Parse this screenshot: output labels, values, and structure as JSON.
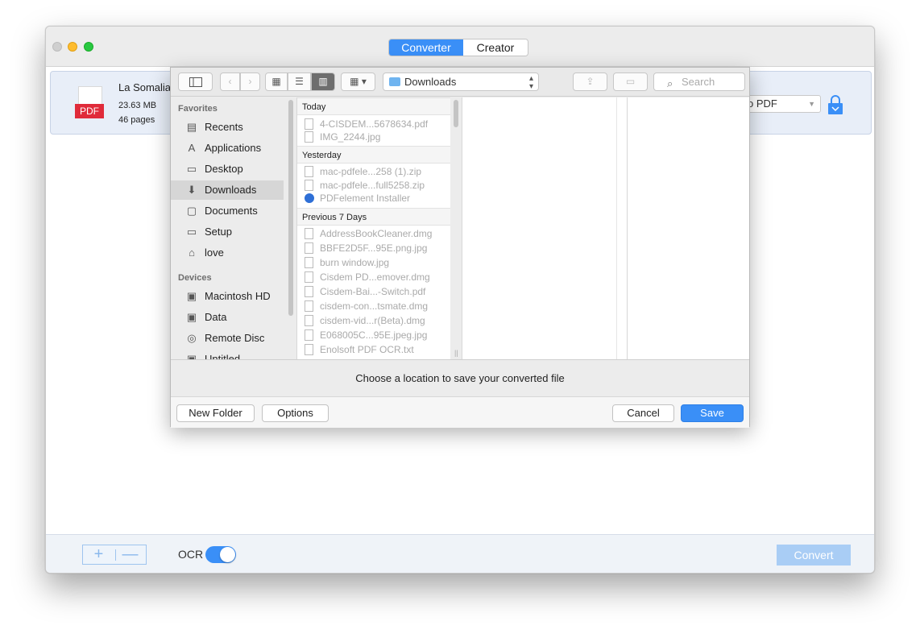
{
  "app": {
    "tabs": [
      {
        "label": "Converter",
        "active": true
      },
      {
        "label": "Creator",
        "active": false
      }
    ],
    "accent_color": "#3a8ff7"
  },
  "file": {
    "name": "La Somalia",
    "badge": "PDF",
    "size": "23.63 MB",
    "pages": "46 pages",
    "format": "o PDF"
  },
  "bottom": {
    "add_label": "+",
    "remove_label": "—",
    "ocr_label": "OCR",
    "ocr_enabled": true,
    "convert_label": "Convert"
  },
  "dialog": {
    "location": "Downloads",
    "search_placeholder": "Search",
    "sidebar": {
      "favorites_header": "Favorites",
      "favorites": [
        {
          "label": "Recents",
          "icon": "recents-icon"
        },
        {
          "label": "Applications",
          "icon": "applications-icon"
        },
        {
          "label": "Desktop",
          "icon": "desktop-icon"
        },
        {
          "label": "Downloads",
          "icon": "downloads-icon",
          "selected": true
        },
        {
          "label": "Documents",
          "icon": "documents-icon"
        },
        {
          "label": "Setup",
          "icon": "folder-icon"
        },
        {
          "label": "love",
          "icon": "home-icon"
        }
      ],
      "devices_header": "Devices",
      "devices": [
        {
          "label": "Macintosh HD",
          "icon": "disk-icon"
        },
        {
          "label": "Data",
          "icon": "disk-icon"
        },
        {
          "label": "Remote Disc",
          "icon": "disc-icon"
        },
        {
          "label": "Untitled",
          "icon": "disk-icon"
        }
      ]
    },
    "groups": [
      {
        "title": "Today",
        "files": [
          "4-CISDEM...5678634.pdf",
          "IMG_2244.jpg"
        ]
      },
      {
        "title": "Yesterday",
        "files": [
          "mac-pdfele...258 (1).zip",
          "mac-pdfele...full5258.zip",
          "PDFelement Installer"
        ]
      },
      {
        "title": "Previous 7 Days",
        "files": [
          "AddressBookCleaner.dmg",
          "BBFE2D5F...95E.png.jpg",
          "burn window.jpg",
          "Cisdem PD...emover.dmg",
          "Cisdem-Bai...-Switch.pdf",
          "cisdem-con...tsmate.dmg",
          "cisdem-vid...r(Beta).dmg",
          "E068005C...95E.jpeg.jpg",
          "Enolsoft PDF OCR.txt"
        ]
      }
    ],
    "message": "Choose a location to save your converted file",
    "new_folder_label": "New Folder",
    "options_label": "Options",
    "cancel_label": "Cancel",
    "save_label": "Save"
  }
}
